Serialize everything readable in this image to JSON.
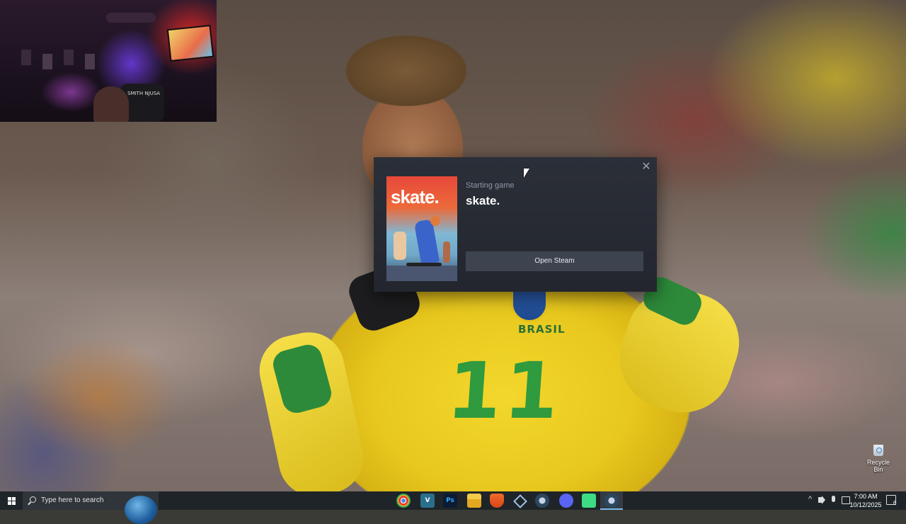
{
  "dialog": {
    "status_text": "Starting game",
    "game_title": "skate.",
    "cover_title": "skate.",
    "open_steam_label": "Open Steam",
    "close_glyph": "✕"
  },
  "desktop": {
    "recycle_bin_label": "Recycle Bin",
    "jersey_number": "11",
    "jersey_text": "BRASIL",
    "webcam_chair_text": "SMITH NJUSA"
  },
  "taskbar": {
    "search_placeholder": "Type here to search",
    "pinned_apps": [
      {
        "name": "chrome",
        "label": ""
      },
      {
        "name": "visual-studio",
        "label": "V"
      },
      {
        "name": "photoshop",
        "label": "Ps"
      },
      {
        "name": "file-explorer",
        "label": ""
      },
      {
        "name": "brave",
        "label": ""
      },
      {
        "name": "extension",
        "label": ""
      },
      {
        "name": "steam",
        "label": ""
      },
      {
        "name": "discord",
        "label": ""
      },
      {
        "name": "android-app",
        "label": ""
      },
      {
        "name": "steam-active",
        "label": ""
      }
    ],
    "clock_time": "7:00 AM",
    "clock_date": "10/12/2025",
    "notification_count": "6",
    "tray_chevron": "^"
  },
  "colors": {
    "dialog_bg": "#2b2f38",
    "button_bg": "#3d4450",
    "taskbar_bg": "#1f2428",
    "accent": "#76b9ed"
  }
}
